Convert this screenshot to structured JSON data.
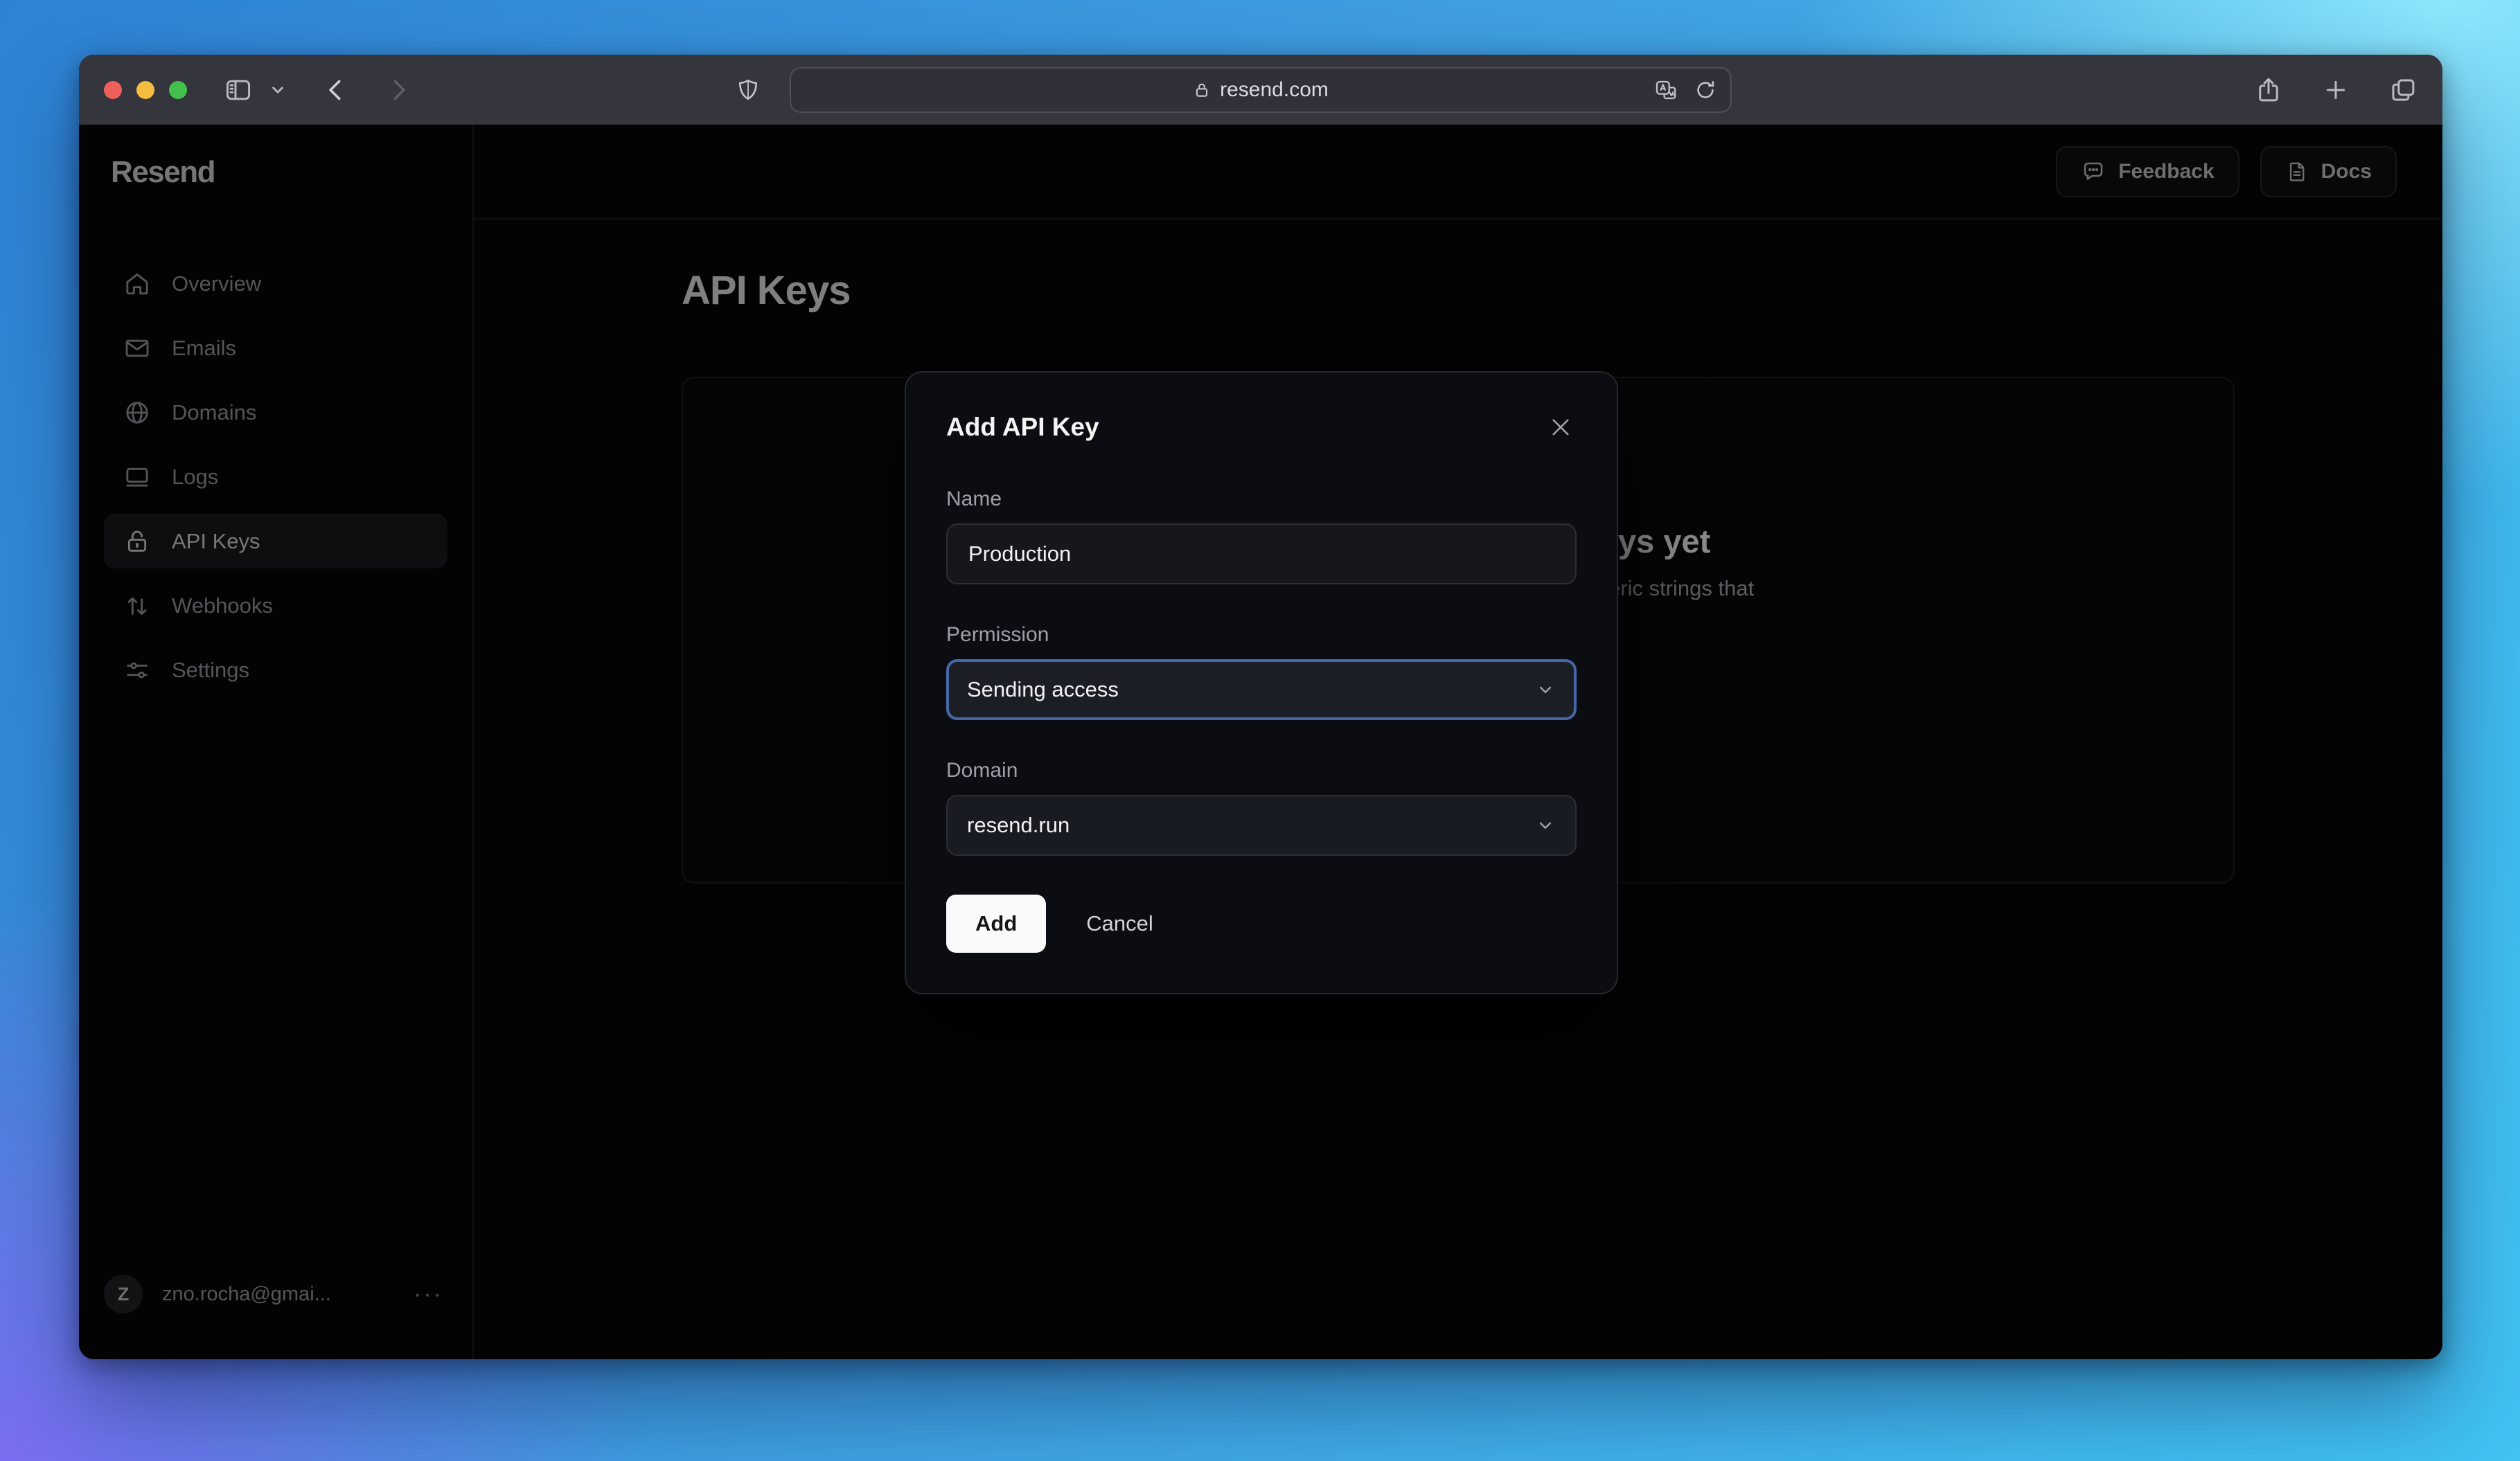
{
  "browser": {
    "url": "resend.com",
    "window_controls": {
      "close": "close",
      "minimize": "minimize",
      "zoom": "zoom"
    }
  },
  "app": {
    "logo": "Resend",
    "topbar": {
      "feedback_label": "Feedback",
      "docs_label": "Docs"
    },
    "sidebar": {
      "items": [
        {
          "label": "Overview",
          "active": false
        },
        {
          "label": "Emails",
          "active": false
        },
        {
          "label": "Domains",
          "active": false
        },
        {
          "label": "Logs",
          "active": false
        },
        {
          "label": "API Keys",
          "active": true
        },
        {
          "label": "Webhooks",
          "active": false
        },
        {
          "label": "Settings",
          "active": false
        }
      ],
      "account": {
        "initial": "Z",
        "email": "zno.rocha@gmai...",
        "menu": "···"
      }
    },
    "page": {
      "title": "API Keys",
      "empty_state": {
        "heading_fragment": "ys yet",
        "body_fragment": "eric strings that"
      }
    }
  },
  "modal": {
    "title": "Add API Key",
    "fields": {
      "name": {
        "label": "Name",
        "value": "Production"
      },
      "permission": {
        "label": "Permission",
        "value": "Sending access"
      },
      "domain": {
        "label": "Domain",
        "value": "resend.run"
      }
    },
    "actions": {
      "add": "Add",
      "cancel": "Cancel"
    }
  },
  "colors": {
    "focus_ring": "#4667a5",
    "traffic_red": "#f0605a",
    "traffic_yellow": "#f5bd40",
    "traffic_green": "#43c04c",
    "modal_bg": "#0b0d12",
    "app_bg": "#060607",
    "titlebar_bg": "#35353d"
  }
}
